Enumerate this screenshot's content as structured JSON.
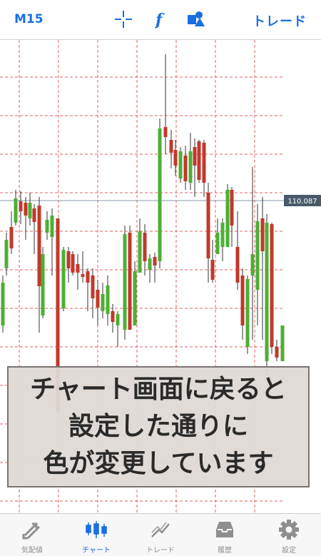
{
  "header": {
    "timeframe": "M15",
    "trade_label": "トレード",
    "icons": [
      "crosshair-icon",
      "indicator-f-icon",
      "objects-icon"
    ]
  },
  "chart": {
    "price_label": "110.087",
    "accent_color": "#1a6fe0",
    "bull_color": "#4caf35",
    "bear_color": "#c0392b",
    "grid_color": "#e06060"
  },
  "overlay": {
    "line1": "チャート画面に戻ると",
    "line2": "設定した通りに",
    "line3": "色が変更しています"
  },
  "tabs": [
    {
      "label": "気配値",
      "icon": "quotes-icon",
      "active": false
    },
    {
      "label": "チャート",
      "icon": "chart-icon",
      "active": true
    },
    {
      "label": "トレード",
      "icon": "trade-icon",
      "active": false
    },
    {
      "label": "履歴",
      "icon": "history-icon",
      "active": false
    },
    {
      "label": "設定",
      "icon": "gear-icon",
      "active": false
    }
  ]
}
